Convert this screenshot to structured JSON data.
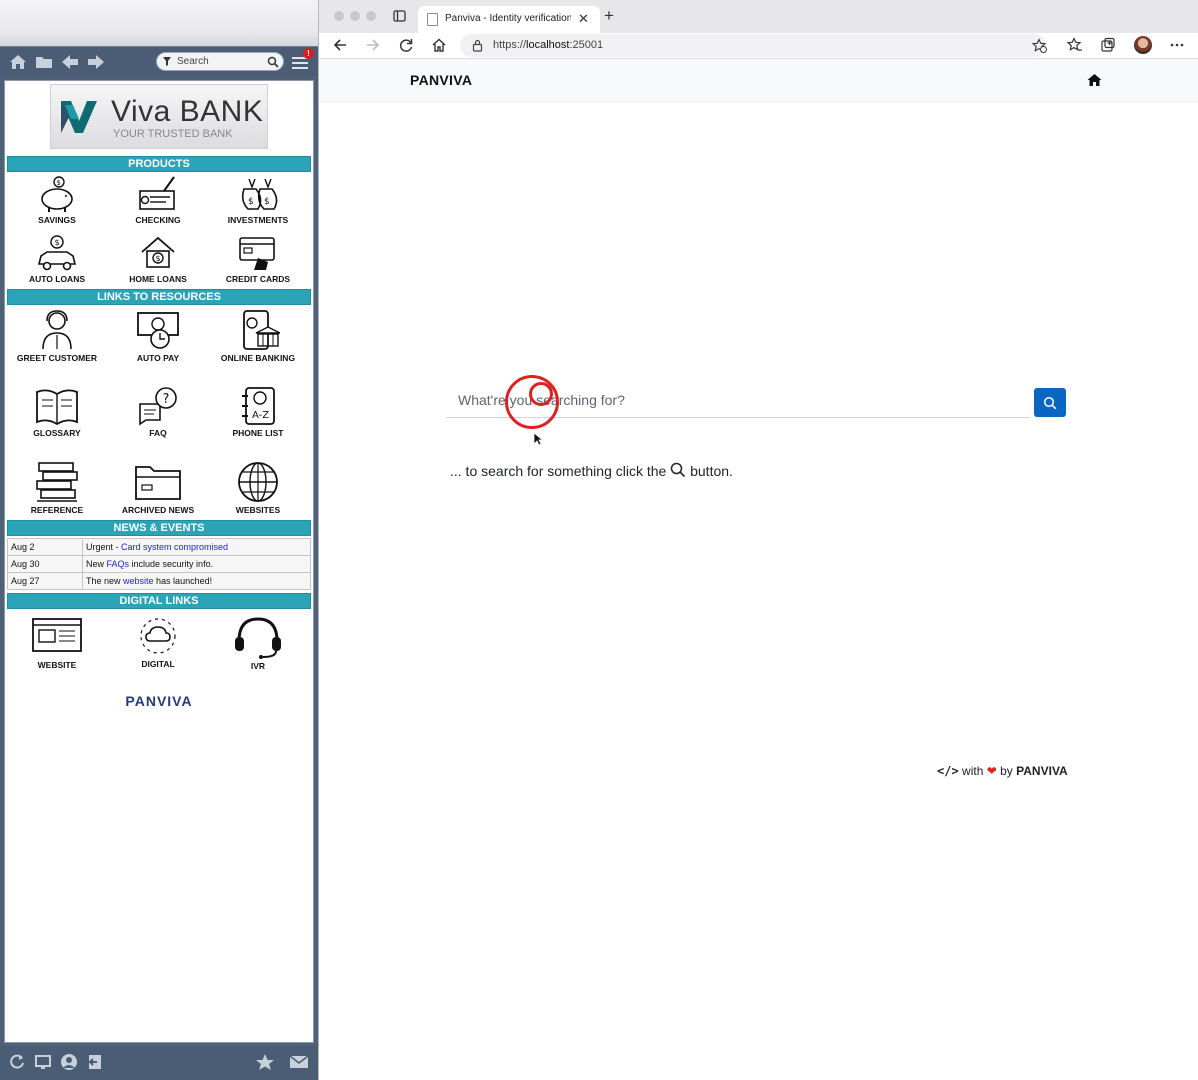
{
  "left_panel": {
    "search_placeholder": "Search",
    "notification_count": "!",
    "logo": {
      "title": "Viva BANK",
      "subtitle": "YOUR TRUSTED BANK"
    },
    "sections": {
      "products": "PRODUCTS",
      "resources": "LINKS TO RESOURCES",
      "news": "NEWS & EVENTS",
      "digital": "DIGITAL LINKS"
    },
    "products": [
      "SAVINGS",
      "CHECKING",
      "INVESTMENTS",
      "AUTO LOANS",
      "HOME LOANS",
      "CREDIT CARDS"
    ],
    "resources": [
      "GREET CUSTOMER",
      "AUTO PAY",
      "ONLINE BANKING",
      "GLOSSARY",
      "FAQ",
      "PHONE LIST",
      "REFERENCE",
      "ARCHIVED NEWS",
      "WEBSITES"
    ],
    "news": [
      {
        "date": "Aug 2",
        "pre": "Urgent - ",
        "link": "Card system compromised",
        "post": ""
      },
      {
        "date": "Aug 30",
        "pre": "New ",
        "link": "FAQs",
        "post": " include security info."
      },
      {
        "date": "Aug 27",
        "pre": "The new ",
        "link": "website",
        "post": " has launched!"
      }
    ],
    "digital": [
      "WEBSITE",
      "DIGITAL",
      "IVR"
    ],
    "footer_logo": "PANVIVA"
  },
  "browser": {
    "tab_title": "Panviva - Identity verification p",
    "url_host": "https://",
    "url_main": "localhost",
    "url_port": ":25001"
  },
  "page": {
    "brand": "PANVIVA",
    "search_placeholder": "What're you searching for?",
    "hint_before": "... to search for something click the",
    "hint_after": "button.",
    "footer": {
      "code": "</>",
      "with": "with",
      "heart": "❤",
      "by": "by",
      "brand": "PANVIVA"
    }
  },
  "colors": {
    "accent_bar": "#2ba4b8",
    "search_button": "#0b66c3",
    "brand_navy": "#233b7a",
    "cursor_ring": "#e02020"
  }
}
